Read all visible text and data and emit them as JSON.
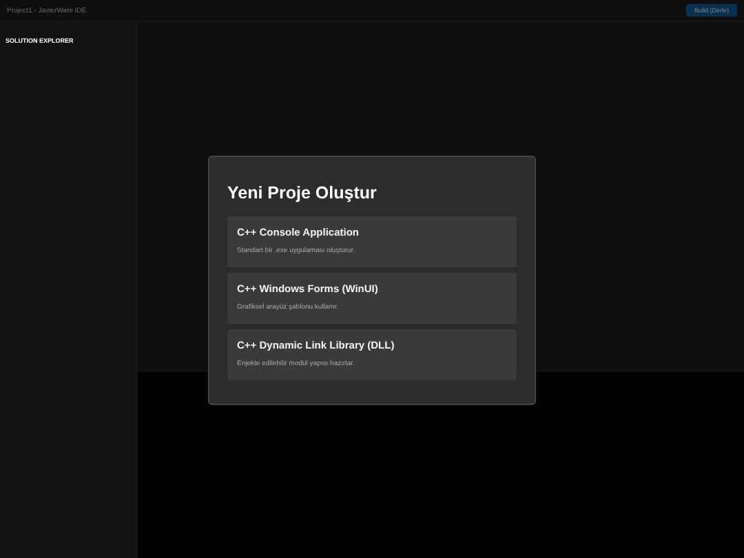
{
  "window": {
    "title": "Project1 - JavierWare IDE"
  },
  "toolbar": {
    "build_button": "Build (Derle)"
  },
  "sidebar": {
    "title": "SOLUTION EXPLORER"
  },
  "dialog": {
    "title": "Yeni Proje Oluştur",
    "options": [
      {
        "title": "C++ Console Application",
        "description": "Standart bir .exe uygulaması oluşturur."
      },
      {
        "title": "C++ Windows Forms (WinUI)",
        "description": "Grafiksel arayüz şablonu kullanır."
      },
      {
        "title": "C++ Dynamic Link Library (DLL)",
        "description": "Enjekte edilebilir modül yapısı hazırlar."
      }
    ]
  }
}
